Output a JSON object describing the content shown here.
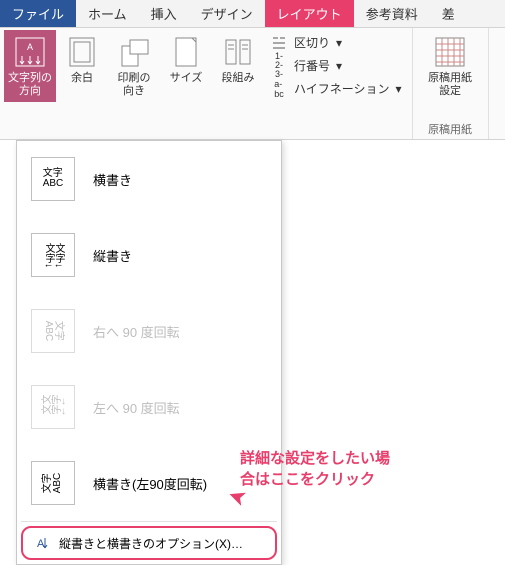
{
  "tabs": {
    "file": "ファイル",
    "home": "ホーム",
    "insert": "挿入",
    "design": "デザイン",
    "layout": "レイアウト",
    "reference": "参考資料",
    "mail": "差"
  },
  "ribbon": {
    "text_direction": "文字列の\n方向",
    "margins": "余白",
    "print_orient": "印刷の\n向き",
    "size": "サイズ",
    "columns": "段組み",
    "breaks": "区切り",
    "line_numbers": "行番号",
    "hyphenation": "ハイフネーション",
    "manuscript": "原稿用紙\n設定",
    "manuscript_group": "原稿用紙"
  },
  "menu": {
    "horizontal": "横書き",
    "vertical": "縦書き",
    "rotate_right": "右へ 90 度回転",
    "rotate_left": "左へ 90 度回転",
    "horizontal_l90": "横書き(左90度回転)",
    "options": "縦書きと横書きのオプション(X)…",
    "thumb_h": "文字\nABC",
    "thumb_v": "文字↓\n文字↓",
    "thumb_r": "文字\nABC",
    "thumb_l": "文字↓\n文字↓",
    "thumb_h90": "文字\nABC"
  },
  "callout": {
    "line1": "詳細な設定をしたい場",
    "line2": "合はここをクリック"
  }
}
